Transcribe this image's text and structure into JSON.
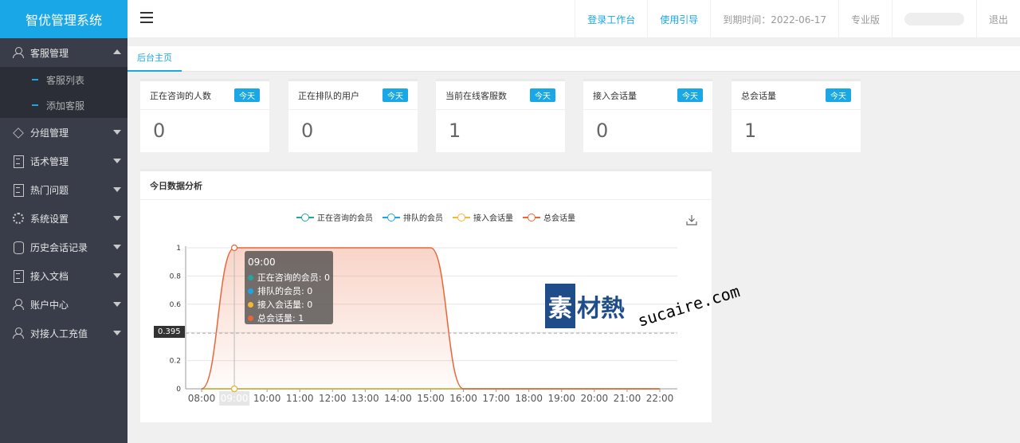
{
  "app": {
    "title": "智优管理系统"
  },
  "sidebar": {
    "items": [
      {
        "label": "客服管理",
        "icon": "user-icon",
        "open": true,
        "children": [
          {
            "label": "客服列表"
          },
          {
            "label": "添加客服"
          }
        ]
      },
      {
        "label": "分组管理",
        "icon": "layers-icon"
      },
      {
        "label": "话术管理",
        "icon": "document-icon"
      },
      {
        "label": "热门问题",
        "icon": "document-icon"
      },
      {
        "label": "系统设置",
        "icon": "gear-icon"
      },
      {
        "label": "历史会话记录",
        "icon": "database-icon"
      },
      {
        "label": "接入文档",
        "icon": "document-icon"
      },
      {
        "label": "账户中心",
        "icon": "user-icon"
      },
      {
        "label": "对接人工充值",
        "icon": "user-icon"
      }
    ]
  },
  "header": {
    "nav": {
      "workbench": "登录工作台",
      "guide": "使用引导",
      "expire": "到期时间：2022-06-17",
      "edition": "专业版",
      "logout": "退出"
    }
  },
  "tabs": {
    "home": "后台主页"
  },
  "cards": [
    {
      "title": "正在咨询的人数",
      "badge": "今天",
      "value": "0"
    },
    {
      "title": "正在排队的用户",
      "badge": "今天",
      "value": "0"
    },
    {
      "title": "当前在线客服数",
      "badge": "今天",
      "value": "1"
    },
    {
      "title": "接入会话量",
      "badge": "今天",
      "value": "0"
    },
    {
      "title": "总会话量",
      "badge": "今天",
      "value": "1"
    }
  ],
  "panel": {
    "title": "今日数据分析"
  },
  "colors": {
    "accent": "#1aa7e8",
    "s1": "#26a69a",
    "s2": "#1aa7e8",
    "s3": "#f5b82e",
    "s4": "#e8663a"
  },
  "chart_data": {
    "type": "line",
    "x": [
      "08:00",
      "09:00",
      "10:00",
      "11:00",
      "12:00",
      "13:00",
      "14:00",
      "15:00",
      "16:00",
      "17:00",
      "18:00",
      "19:00",
      "20:00",
      "21:00",
      "22:00"
    ],
    "series": [
      {
        "name": "正在咨询的会员",
        "values": [
          0,
          0,
          0,
          0,
          0,
          0,
          0,
          0,
          0,
          0,
          0,
          0,
          0,
          0,
          0
        ]
      },
      {
        "name": "排队的会员",
        "values": [
          0,
          0,
          0,
          0,
          0,
          0,
          0,
          0,
          0,
          0,
          0,
          0,
          0,
          0,
          0
        ]
      },
      {
        "name": "接入会话量",
        "values": [
          0,
          0,
          0,
          0,
          0,
          0,
          0,
          0,
          0,
          0,
          0,
          0,
          0,
          0,
          0
        ]
      },
      {
        "name": "总会话量",
        "values": [
          0,
          1,
          1,
          1,
          1,
          1,
          1,
          1,
          0,
          0,
          0,
          0,
          0,
          0,
          0
        ]
      }
    ],
    "ylim": [
      0,
      1
    ],
    "yticks": [
      "0",
      "0.2",
      "0.4",
      "0.6",
      "0.8",
      "1"
    ],
    "tooltip": {
      "title": "09:00",
      "rows": [
        "正在咨询的会员: 0",
        "排队的会员: 0",
        "接入会话量: 0",
        "总会话量: 1"
      ]
    },
    "pointer_value": "0.395",
    "grid": true,
    "legend_position": "top"
  },
  "watermark": {
    "badge": "素",
    "text": "材熱",
    "url": "sucaire.com"
  }
}
